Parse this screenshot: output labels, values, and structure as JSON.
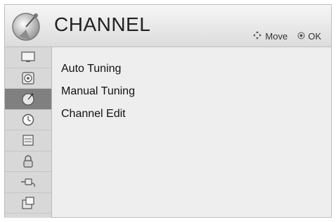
{
  "header": {
    "title": "CHANNEL",
    "move_label": "Move",
    "ok_label": "OK"
  },
  "sidebar": {
    "items": [
      {
        "icon": "picture-icon"
      },
      {
        "icon": "audio-icon"
      },
      {
        "icon": "channel-satellite-icon",
        "active": true
      },
      {
        "icon": "time-icon"
      },
      {
        "icon": "option-icon"
      },
      {
        "icon": "lock-icon"
      },
      {
        "icon": "input-icon"
      },
      {
        "icon": "my-media-icon"
      }
    ]
  },
  "menu": {
    "items": [
      {
        "label": "Auto Tuning"
      },
      {
        "label": "Manual Tuning"
      },
      {
        "label": "Channel Edit"
      }
    ]
  },
  "colors": {
    "active_tab": "#808080",
    "sidebar": "#d8d8d8",
    "content": "#eeeeee"
  }
}
